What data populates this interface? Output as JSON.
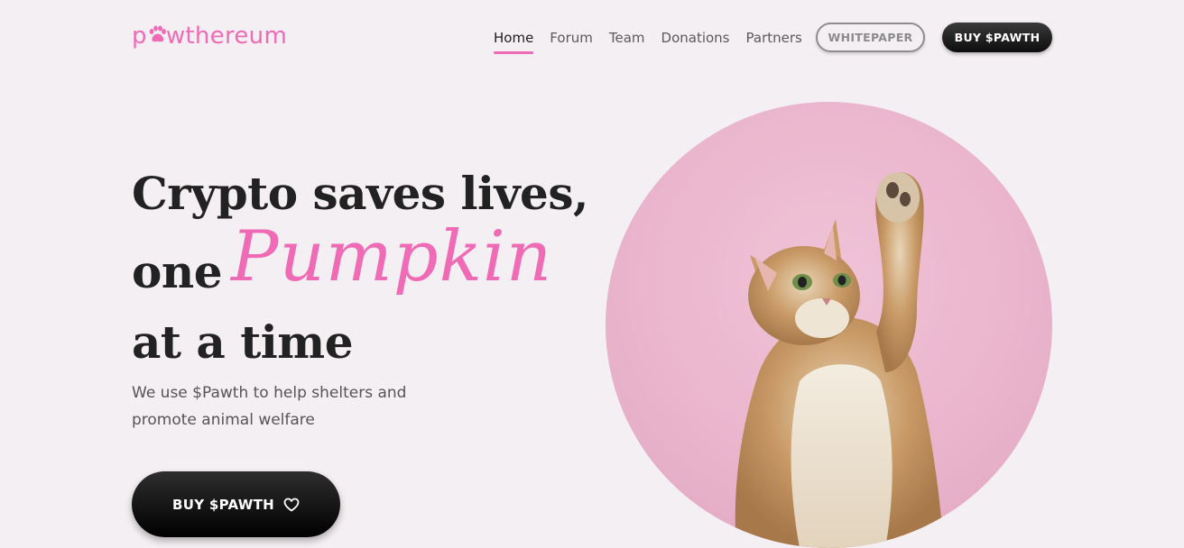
{
  "header": {
    "logo": {
      "prefix": "p",
      "suffix": "wthereum",
      "icon": "paw-icon",
      "color": "#f06bb5"
    },
    "nav": [
      {
        "label": "Home",
        "active": true
      },
      {
        "label": "Forum",
        "active": false
      },
      {
        "label": "Team",
        "active": false
      },
      {
        "label": "Donations",
        "active": false
      },
      {
        "label": "Partners",
        "active": false
      }
    ],
    "whitepaper_label": "WHITEPAPER",
    "buy_label": "BUY $PAWTH"
  },
  "hero": {
    "title_line1": "Crypto saves lives,",
    "title_line2_prefix": "one",
    "title_highlight": "Pumpkin",
    "title_line3": "at a time",
    "subtitle": "We use $Pawth to help shelters and promote animal welfare",
    "cta_label": "BUY $PAWTH",
    "cta_icon": "heart-icon"
  },
  "image": {
    "subject": "cat-reaching-up-icon",
    "background": "#edbad0"
  },
  "colors": {
    "accent": "#f06bb5",
    "background": "#f4eff3",
    "text": "#222222"
  }
}
